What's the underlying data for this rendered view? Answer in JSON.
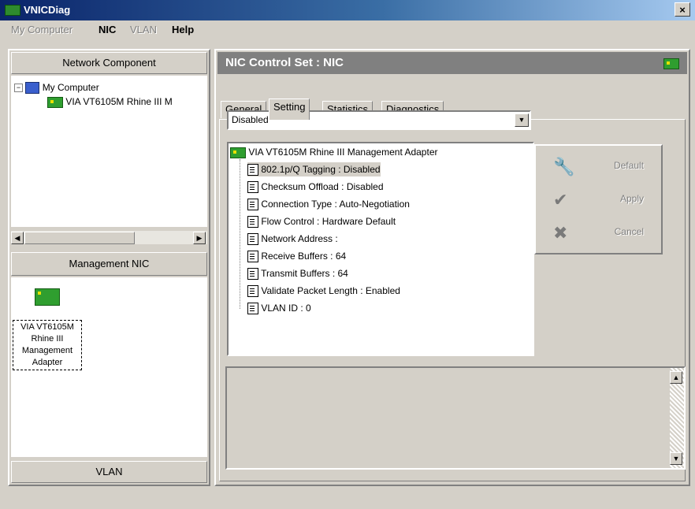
{
  "window": {
    "title": "VNICDiag",
    "close_label": "×"
  },
  "menu": [
    {
      "label": "My Computer",
      "enabled": false
    },
    {
      "label": "NIC",
      "enabled": true
    },
    {
      "label": "VLAN",
      "enabled": false
    },
    {
      "label": "Help",
      "enabled": true
    }
  ],
  "left": {
    "network_header": "Network Component",
    "tree_root": "My Computer",
    "tree_child": "VIA VT6105M Rhine III M",
    "management_header": "Management NIC",
    "management_item_label": "VIA VT6105M Rhine III Management Adapter",
    "vlan_footer": "VLAN"
  },
  "right": {
    "header_title": "NIC Control Set : NIC",
    "tabs": [
      "General",
      "Setting",
      "Statistics",
      "Diagnostics"
    ],
    "active_tab": "Setting",
    "dropdown_value": "Disabled",
    "adapter_name": "VIA VT6105M Rhine III Management Adapter",
    "settings": [
      "802.1p/Q Tagging : Disabled",
      "Checksum Offload : Disabled",
      "Connection Type : Auto-Negotiation",
      "Flow Control : Hardware Default",
      "Network Address :",
      "Receive Buffers : 64",
      "Transmit Buffers : 64",
      "Validate Packet Length : Enabled",
      "VLAN ID : 0"
    ],
    "actions": {
      "default_label": "Default",
      "apply_label": "Apply",
      "cancel_label": "Cancel"
    }
  },
  "icons": {
    "app": "nic-app-icon",
    "computer": "computer-icon",
    "nic": "network-card-icon",
    "setting": "property-page-icon",
    "default": "wrench-icon",
    "apply": "checkmark-icon",
    "cancel": "x-icon"
  },
  "colors": {
    "title_bar": "#0a246a",
    "panel_header": "#808080",
    "selection": "#d4d0c8"
  }
}
